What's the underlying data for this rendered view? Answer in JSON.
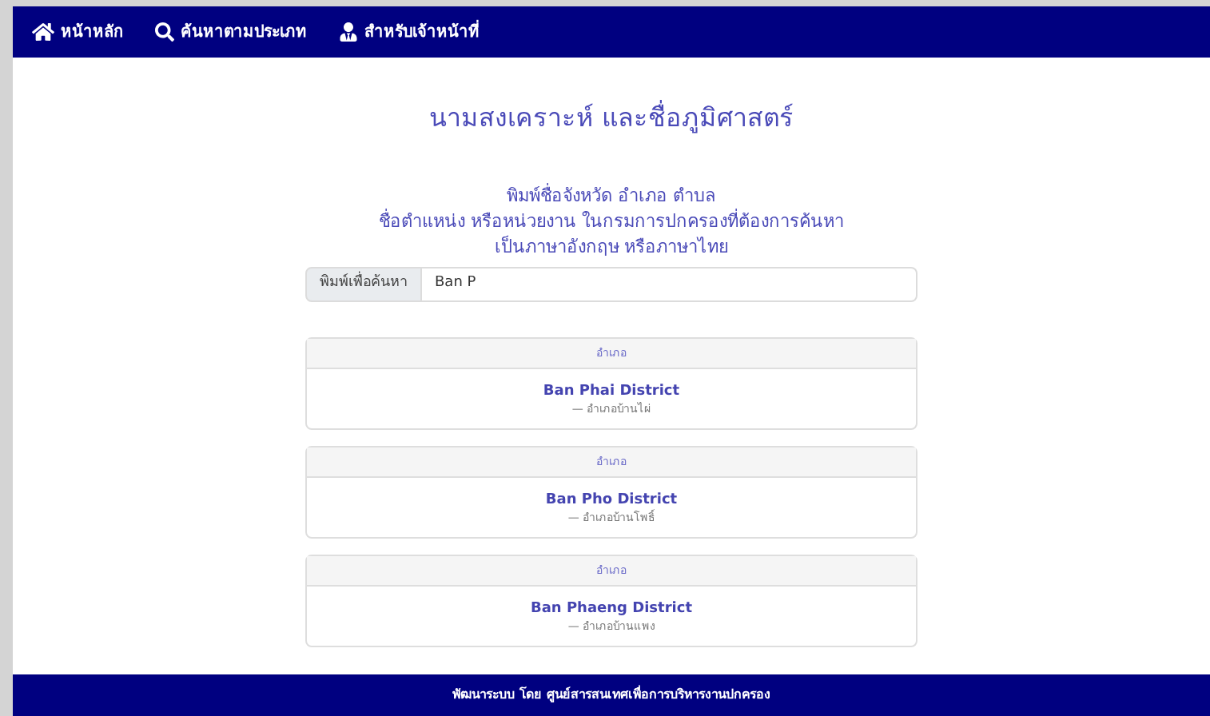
{
  "nav": [
    {
      "label": "หน้าหลัก"
    },
    {
      "label": "ค้นหาตามประเภท"
    },
    {
      "label": "สำหรับเจ้าหน้าที่"
    }
  ],
  "title": "นามสงเคราะห์ และชื่อภูมิศาสตร์",
  "description": [
    "พิมพ์ชื่อจังหวัด อำเภอ ตำบล",
    "ชื่อตำแหน่ง หรือหน่วยงาน ในกรมการปกครองที่ต้องการค้นหา",
    "เป็นภาษาอังกฤษ หรือภาษาไทย"
  ],
  "search": {
    "label": "พิมพ์เพื่อค้นหา",
    "value": "Ban P"
  },
  "results": [
    {
      "type": "อำเภอ",
      "name": "Ban Phai District",
      "thai": "— อำเภอบ้านไผ่"
    },
    {
      "type": "อำเภอ",
      "name": "Ban Pho District",
      "thai": "— อำเภอบ้านโพธิ์"
    },
    {
      "type": "อำเภอ",
      "name": "Ban Phaeng District",
      "thai": "— อำเภอบ้านแพง"
    }
  ],
  "footer": "พัฒนาระบบ โดย ศูนย์สารสนเทศเพื่อการบริหารงานปกครอง"
}
